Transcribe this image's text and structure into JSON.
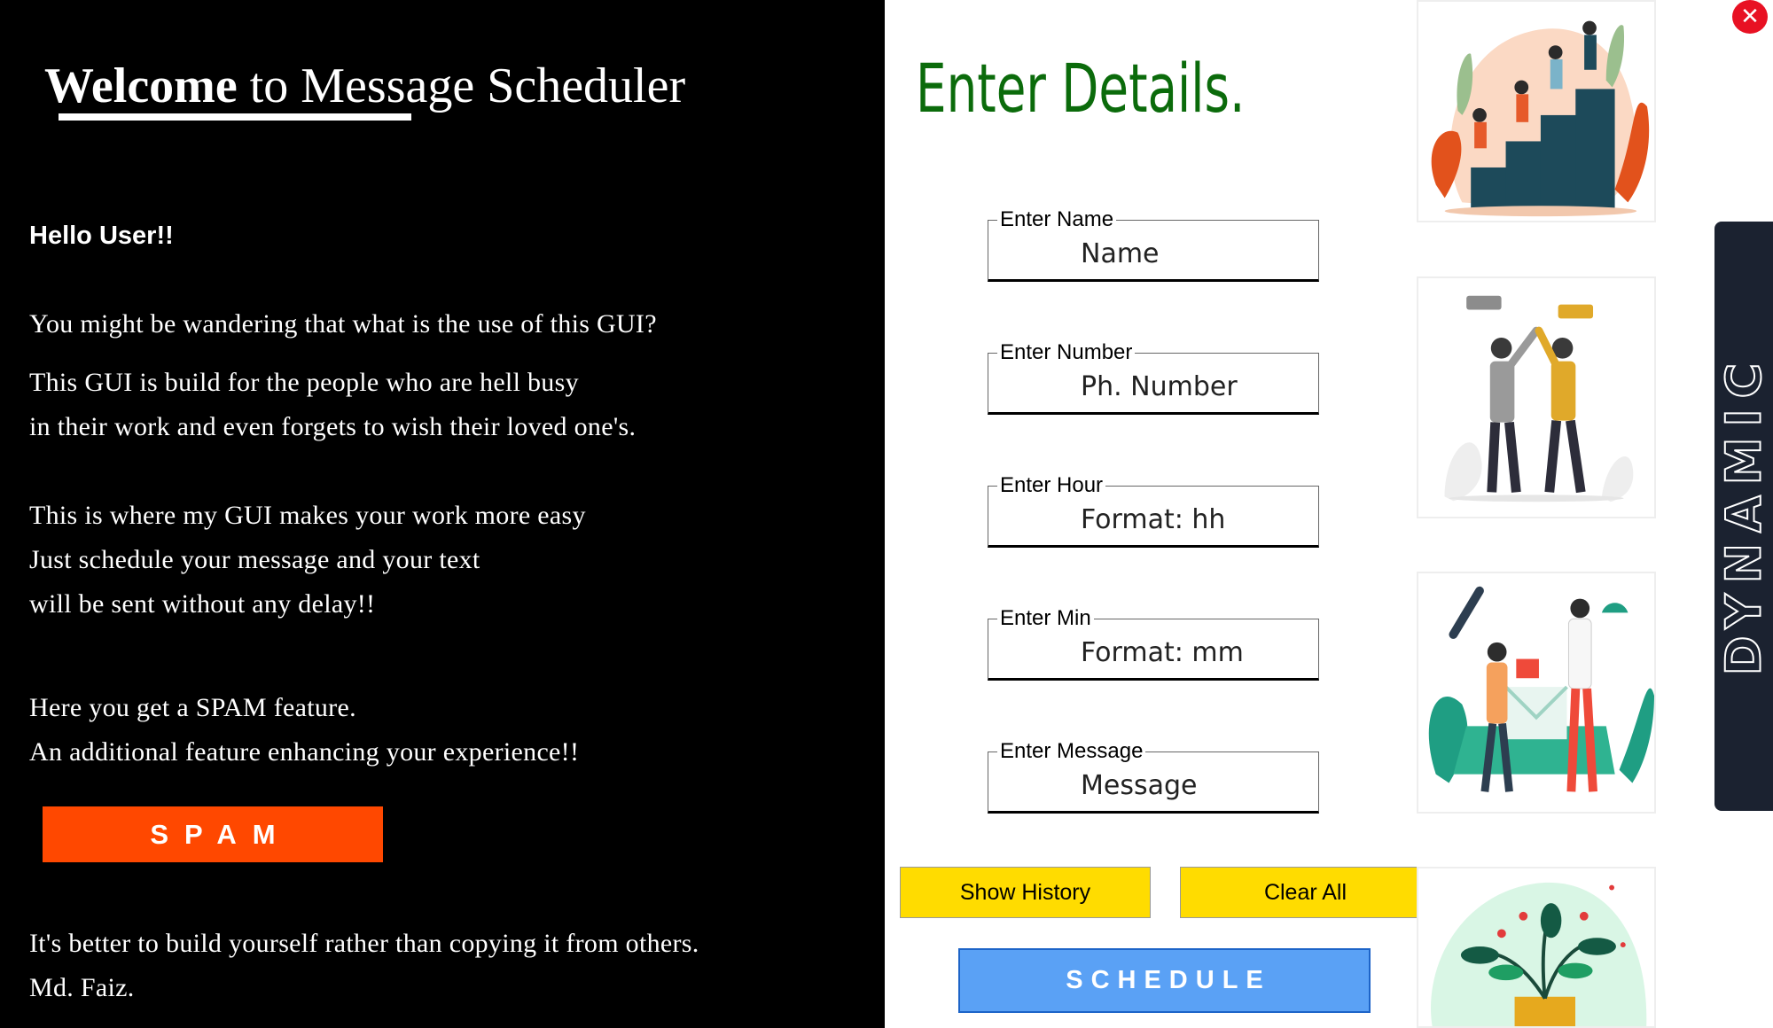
{
  "window": {
    "close_glyph": "✕"
  },
  "left_panel": {
    "title_bold": "Welcome",
    "title_rest": " to Message Scheduler",
    "greeting": "Hello User!!",
    "lines": [
      "You might be wandering that what is the use of this GUI?",
      "This GUI is build for the people who are hell busy",
      "in their work and even forgets to wish their loved one's.",
      "This is where my GUI makes your work more easy",
      "Just schedule your message and your text",
      "will be sent without any delay!!",
      "Here you get a SPAM feature.",
      "An additional feature enhancing your experience!!",
      "It's better to build yourself rather than copying it from others.",
      "Md. Faiz."
    ],
    "spam_label": "SPAM",
    "spam_color": "#ff4800"
  },
  "form": {
    "heading": "Enter Details.",
    "heading_color": "#0b6b0b",
    "fields": [
      {
        "legend": "Enter Name",
        "placeholder": "Name"
      },
      {
        "legend": "Enter Number",
        "placeholder": "Ph. Number"
      },
      {
        "legend": "Enter Hour",
        "placeholder": "Format: hh"
      },
      {
        "legend": "Enter Min",
        "placeholder": "Format: mm"
      },
      {
        "legend": "Enter Message",
        "placeholder": "Message"
      }
    ],
    "show_history_label": "Show History",
    "clear_all_label": "Clear All",
    "schedule_label": "SCHEDULE",
    "button_yellow": "#ffdc00",
    "schedule_color": "#5aa1f5"
  },
  "side": {
    "banner_text": "DYNAMIC",
    "banner_color": "#1b2230"
  },
  "illustrations": [
    {
      "icon": "team-climbing-stairs-illustration"
    },
    {
      "icon": "high-five-illustration"
    },
    {
      "icon": "celebrating-envelope-illustration"
    },
    {
      "icon": "potted-plant-illustration"
    }
  ]
}
